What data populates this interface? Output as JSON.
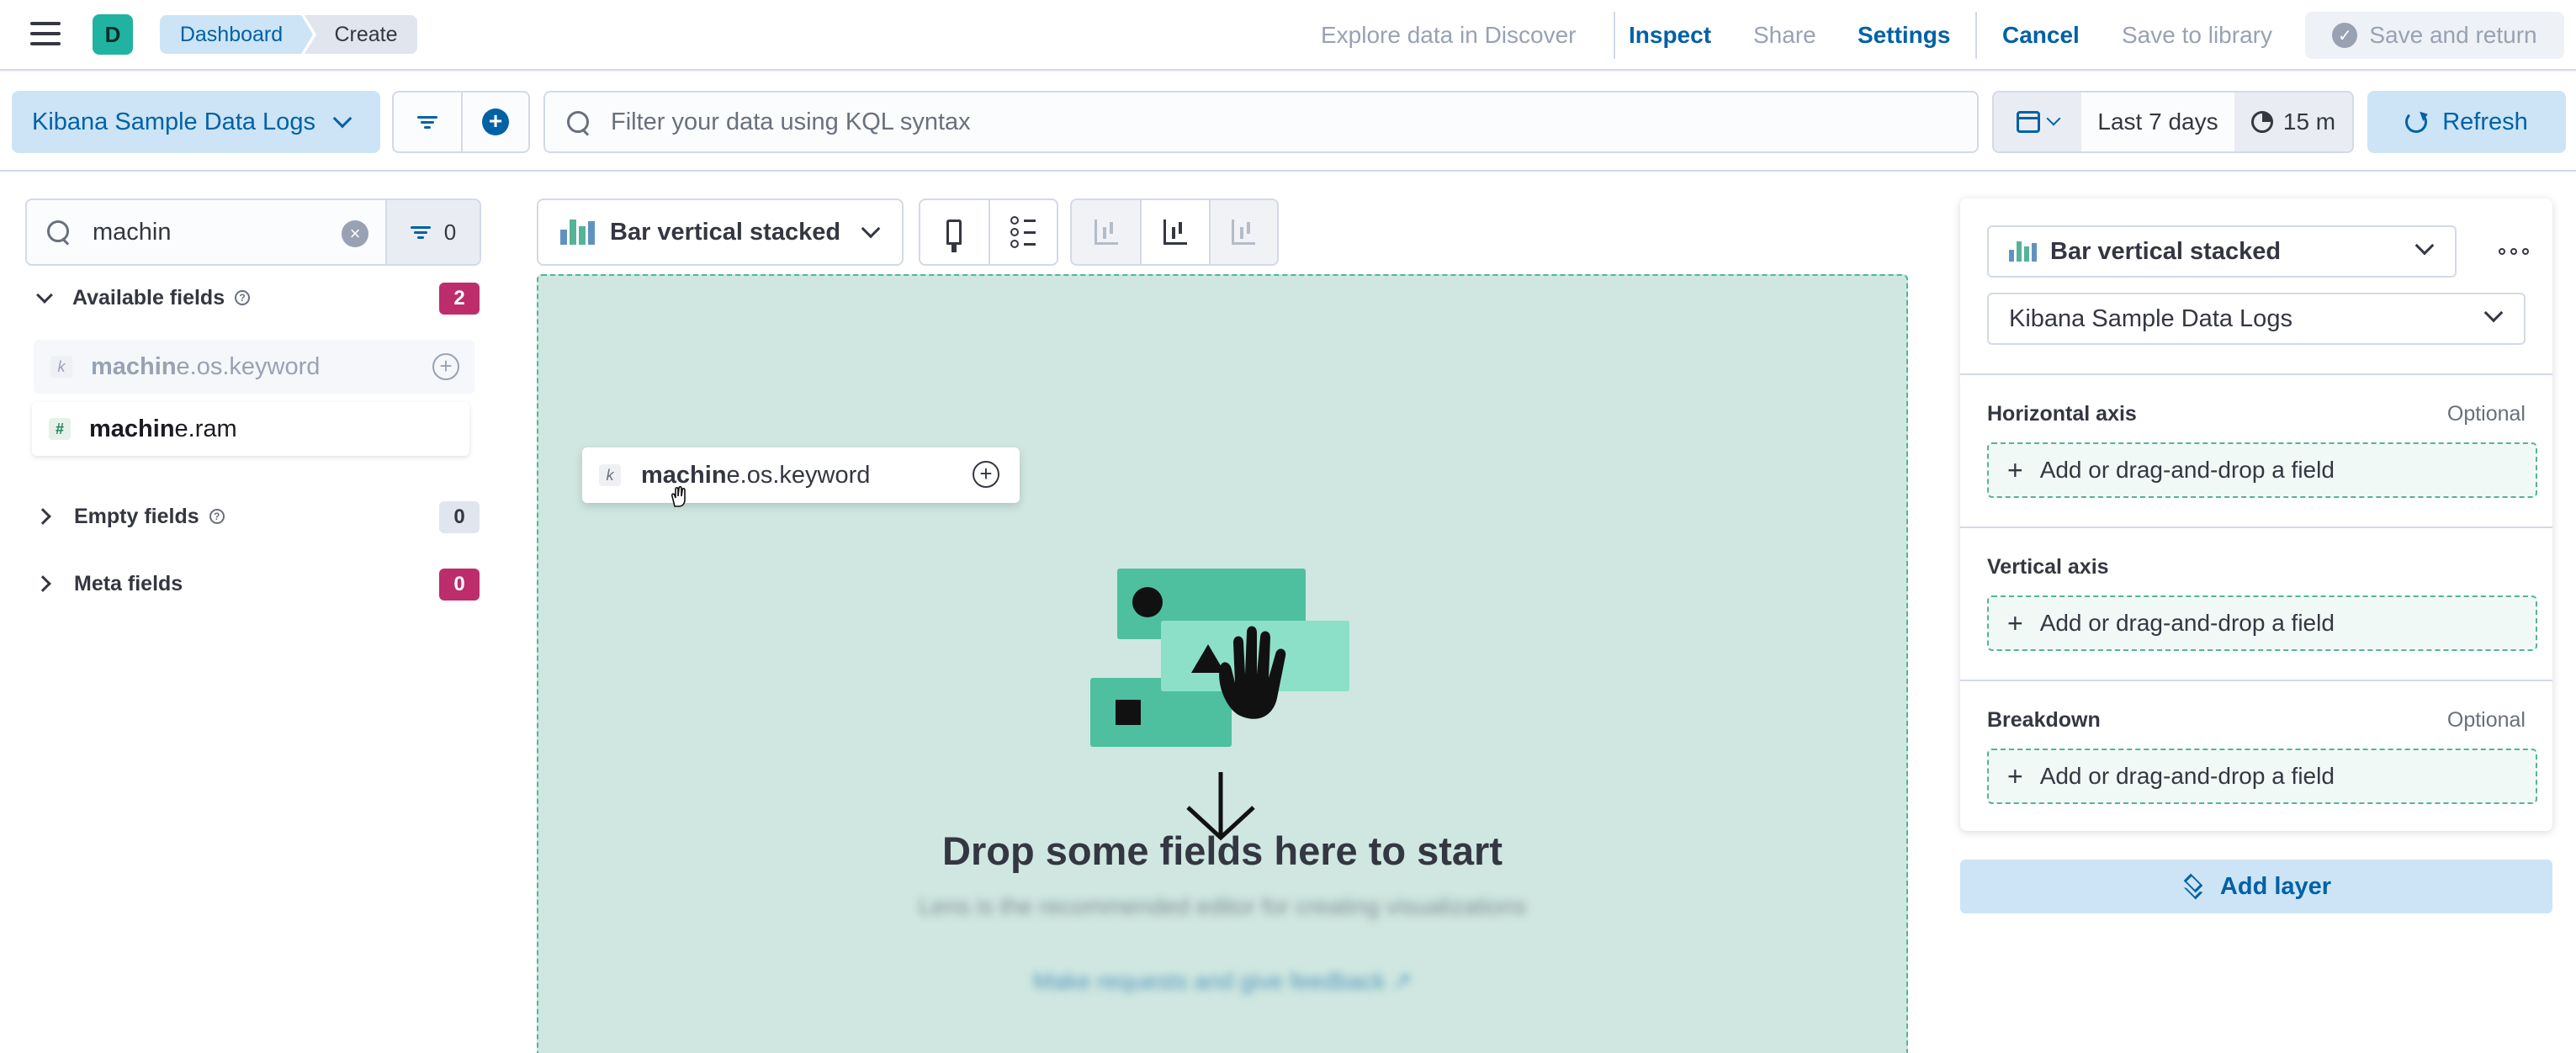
{
  "header": {
    "space_initial": "D",
    "breadcrumbs": [
      "Dashboard",
      "Create"
    ],
    "links": {
      "explore": "Explore data in Discover",
      "inspect": "Inspect",
      "share": "Share",
      "settings": "Settings",
      "cancel": "Cancel",
      "save_library": "Save to library",
      "save_return": "Save and return"
    }
  },
  "query_bar": {
    "data_view": "Kibana Sample Data Logs",
    "kql_placeholder": "Filter your data using KQL syntax",
    "time_range": "Last 7 days",
    "refresh_interval": "15 m",
    "refresh_label": "Refresh"
  },
  "field_list": {
    "search_value": "machin",
    "filter_count": "0",
    "sections": {
      "available": {
        "label": "Available fields",
        "count": "2"
      },
      "empty": {
        "label": "Empty fields",
        "count": "0"
      },
      "meta": {
        "label": "Meta fields",
        "count": "0"
      }
    },
    "fields": [
      {
        "type": "k",
        "match": "machin",
        "rest": "e.os.keyword"
      },
      {
        "type": "#",
        "match": "machin",
        "rest": "e.ram"
      }
    ]
  },
  "workspace": {
    "vis_type": "Bar vertical stacked",
    "drag_chip": {
      "type": "k",
      "match": "machin",
      "rest": "e.os.keyword"
    },
    "drop_title": "Drop some fields here to start",
    "drop_subtitle": "Lens is the recommended editor for creating visualizations",
    "drop_link": "Make requests and give feedback ↗"
  },
  "config": {
    "vis_type": "Bar vertical stacked",
    "data_view": "Kibana Sample Data Logs",
    "groups": [
      {
        "label": "Horizontal axis",
        "optional": "Optional",
        "placeholder": "Add or drag-and-drop a field"
      },
      {
        "label": "Vertical axis",
        "optional": "",
        "placeholder": "Add or drag-and-drop a field"
      },
      {
        "label": "Breakdown",
        "optional": "Optional",
        "placeholder": "Add or drag-and-drop a field"
      }
    ],
    "add_layer": "Add layer"
  },
  "colors": {
    "primary": "#0061a6",
    "primary_light": "#cce4f5",
    "accent_pink": "#bd2d6c",
    "success_teal": "#54b399",
    "drop_zone_bg": "#cfe7e0"
  }
}
